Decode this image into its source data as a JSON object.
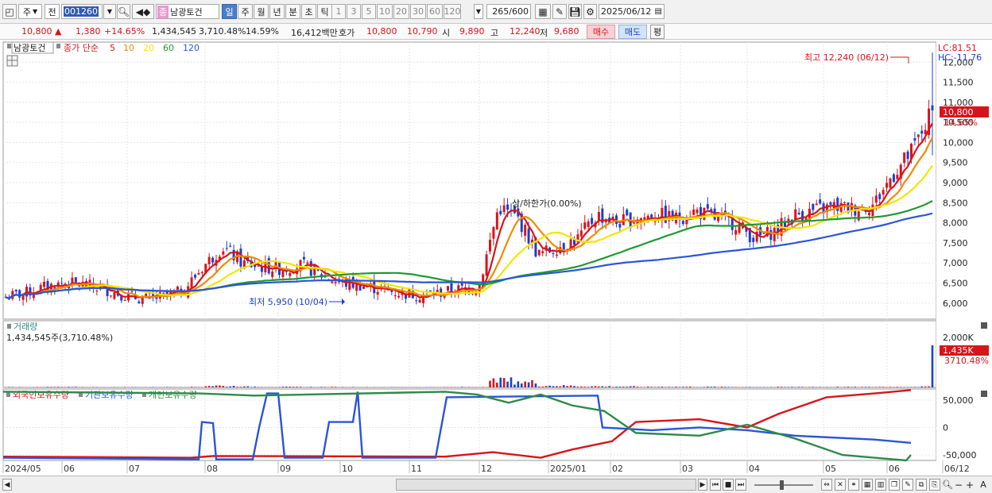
{
  "toolbar": {
    "type_label": "주",
    "prev_label": "전",
    "code_value": "001260",
    "stock_badge": "종",
    "stock_name": "남광토건",
    "periods": [
      "일",
      "주",
      "월",
      "년",
      "분",
      "초",
      "틱"
    ],
    "active_period": "일",
    "intervals": [
      "1",
      "3",
      "5",
      "10",
      "20",
      "30",
      "60",
      "120"
    ],
    "count_value": "265",
    "count_max": "/600",
    "date_value": "2025/06/12"
  },
  "quote": {
    "price": "10,800 ▲",
    "change": "1,380",
    "change_pct": "+14.65%",
    "volume": "1,434,545",
    "volume_pct": "3,710.48%",
    "turnover": "14.59%",
    "amount": "16,412백만",
    "bid_label": "호가",
    "ask_price": "10,800",
    "bid_price": "10,790",
    "open_label": "시",
    "open_value": "9,890",
    "high_label": "고",
    "high_value": "12,240",
    "low_label": "저",
    "low_value": "9,680",
    "buy_label": "매수",
    "sell_label": "매도",
    "eval_label": "평"
  },
  "colors": {
    "up": "#d8141b",
    "down": "#1b3fd0",
    "ma5": "#d8141b",
    "ma10": "#f08a00",
    "ma20": "#f2e600",
    "ma60": "#1e9a2e",
    "ma120": "#2a55d8",
    "foreign": "#d8141b",
    "institution": "#2a55d8",
    "individual": "#2f8a4a"
  },
  "price_panel": {
    "stock_label": "남광토건",
    "legend_prefix": "종가 단순",
    "ma_periods": [
      "5",
      "10",
      "20",
      "60",
      "120"
    ],
    "lc_label": "LC:81.51",
    "hc_label": "HC:-11.76",
    "high_annotation": "최고 12,240 (06/12)",
    "low_annotation": "최저 5,950 (10/04)",
    "tooltip": "상/하한가(0.00%)",
    "current_price": "10,800",
    "current_pct": "14.65%",
    "y_ticks": [
      "6,000",
      "6,500",
      "7,000",
      "7,500",
      "8,000",
      "8,500",
      "9,000",
      "9,500",
      "10,000",
      "10,500",
      "11,000",
      "11,500",
      "12,000"
    ]
  },
  "volume_panel": {
    "title": "거래량",
    "value_label": "1,434,545주(3,710.48%)",
    "y_tick": "2,000K",
    "current": "1,435K",
    "current_pct": "3710.48%"
  },
  "holding_panel": {
    "legend": [
      "외국인보유수량",
      "기관보유수량",
      "개인보유수량"
    ],
    "y_ticks": [
      "50,000",
      "0",
      "-50,000"
    ]
  },
  "x_axis": [
    "2024/05",
    "06",
    "07",
    "08",
    "09",
    "10",
    "11",
    "12",
    "2025/01",
    "02",
    "03",
    "04",
    "05",
    "06",
    "06/12"
  ],
  "chart_data": {
    "type": "candlestick",
    "x_range": [
      "2024/05",
      "2025/06/12"
    ],
    "price_ylim": [
      5950,
      12240
    ],
    "highest": {
      "value": 12240,
      "date": "06/12"
    },
    "lowest": {
      "value": 5950,
      "date": "10/04"
    },
    "last_close": 10800,
    "close_series": [
      6150,
      6250,
      6400,
      6500,
      6450,
      6350,
      6200,
      6100,
      6150,
      6300,
      6900,
      7400,
      7000,
      6900,
      6850,
      6950,
      6700,
      6500,
      6450,
      6350,
      6250,
      6200,
      6250,
      6350,
      6400,
      8400,
      8100,
      7200,
      7400,
      7600,
      8200,
      8000,
      8100,
      8200,
      8100,
      8300,
      8100,
      8000,
      7600,
      7800,
      8200,
      8300,
      8400,
      8350,
      8450,
      9200,
      9800,
      10800
    ],
    "volume_series": [
      12,
      10,
      15,
      14,
      10,
      9,
      11,
      10,
      12,
      15,
      60,
      45,
      25,
      20,
      18,
      15,
      14,
      12,
      10,
      9,
      8,
      9,
      10,
      12,
      15,
      240,
      180,
      60,
      55,
      40,
      35,
      30,
      20,
      25,
      22,
      20,
      18,
      16,
      14,
      15,
      18,
      16,
      17,
      15,
      18,
      20,
      25,
      1435
    ],
    "volume_ylim": [
      0,
      2000
    ],
    "holding_ylim": [
      -60000,
      70000
    ]
  }
}
